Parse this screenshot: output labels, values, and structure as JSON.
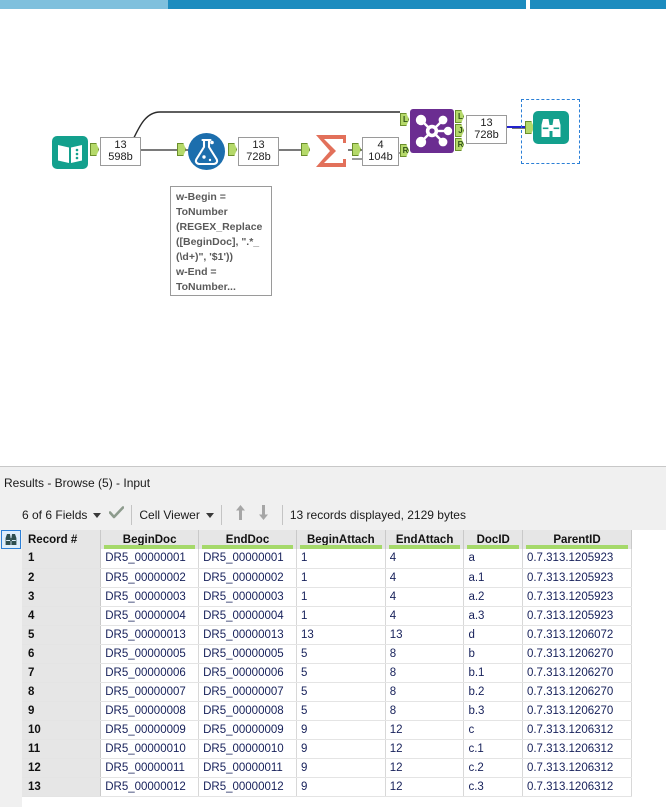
{
  "window": {
    "tab_strip_visible": true
  },
  "canvas": {
    "tools": [
      {
        "id": "input-data",
        "name": "Input Data",
        "icon": "book-icon",
        "color": "#13a08d"
      },
      {
        "id": "formula",
        "name": "Formula",
        "icon": "flask-icon",
        "color": "#1c6ead"
      },
      {
        "id": "summarize",
        "name": "Summarize",
        "icon": "sigma-icon",
        "color": "#e2705a"
      },
      {
        "id": "join",
        "name": "Join",
        "icon": "join-nodes-icon",
        "color": "#6b2d91"
      },
      {
        "id": "browse",
        "name": "Browse",
        "icon": "binoculars-icon",
        "color": "#13a08d"
      }
    ],
    "connection_labels": [
      {
        "id": "input-out",
        "count": "13",
        "size": "598b"
      },
      {
        "id": "formula-out",
        "count": "13",
        "size": "728b"
      },
      {
        "id": "summarize-out",
        "count": "4",
        "size": "104b"
      },
      {
        "id": "join-out",
        "count": "13",
        "size": "728b"
      }
    ],
    "join_anchors": {
      "inputs": [
        "L",
        "R"
      ],
      "outputs": [
        "L",
        "J",
        "R"
      ]
    },
    "annotation": "w-Begin =\nToNumber\n(REGEX_Replace\n([BeginDoc], \".*_\n(\\d+)\", '$1'))\nw-End =\nToNumber..."
  },
  "results": {
    "title": "Results - Browse (5) - Input",
    "toolbar": {
      "list_icon": "list-icon",
      "browse_icon": "binoculars-icon",
      "fields_label": "6 of 6 Fields",
      "check_icon": "check-icon",
      "viewer_label": "Cell Viewer",
      "sort_up_icon": "arrow-up-icon",
      "sort_down_icon": "arrow-down-icon",
      "status": "13 records displayed, 2129 bytes"
    },
    "table": {
      "columns": [
        "Record #",
        "BeginDoc",
        "EndDoc",
        "BeginAttach",
        "EndAttach",
        "DocID",
        "ParentID"
      ],
      "rows": [
        [
          "1",
          "DR5_00000001",
          "DR5_00000001",
          "1",
          "4",
          "a",
          "0.7.313.1205923"
        ],
        [
          "2",
          "DR5_00000002",
          "DR5_00000002",
          "1",
          "4",
          "a.1",
          "0.7.313.1205923"
        ],
        [
          "3",
          "DR5_00000003",
          "DR5_00000003",
          "1",
          "4",
          "a.2",
          "0.7.313.1205923"
        ],
        [
          "4",
          "DR5_00000004",
          "DR5_00000004",
          "1",
          "4",
          "a.3",
          "0.7.313.1205923"
        ],
        [
          "5",
          "DR5_00000013",
          "DR5_00000013",
          "13",
          "13",
          "d",
          "0.7.313.1206072"
        ],
        [
          "6",
          "DR5_00000005",
          "DR5_00000005",
          "5",
          "8",
          "b",
          "0.7.313.1206270"
        ],
        [
          "7",
          "DR5_00000006",
          "DR5_00000006",
          "5",
          "8",
          "b.1",
          "0.7.313.1206270"
        ],
        [
          "8",
          "DR5_00000007",
          "DR5_00000007",
          "5",
          "8",
          "b.2",
          "0.7.313.1206270"
        ],
        [
          "9",
          "DR5_00000008",
          "DR5_00000008",
          "5",
          "8",
          "b.3",
          "0.7.313.1206270"
        ],
        [
          "10",
          "DR5_00000009",
          "DR5_00000009",
          "9",
          "12",
          "c",
          "0.7.313.1206312"
        ],
        [
          "11",
          "DR5_00000010",
          "DR5_00000010",
          "9",
          "12",
          "c.1",
          "0.7.313.1206312"
        ],
        [
          "12",
          "DR5_00000011",
          "DR5_00000011",
          "9",
          "12",
          "c.2",
          "0.7.313.1206312"
        ],
        [
          "13",
          "DR5_00000012",
          "DR5_00000012",
          "9",
          "12",
          "c.3",
          "0.7.313.1206312"
        ]
      ]
    }
  },
  "colors": {
    "accent_blue": "#1c8cbf",
    "teal": "#13a08d",
    "purple": "#6b2d91",
    "salmon": "#e2705a",
    "green_typebar": "#a5d96a",
    "select_blue": "#2b7fd6"
  }
}
